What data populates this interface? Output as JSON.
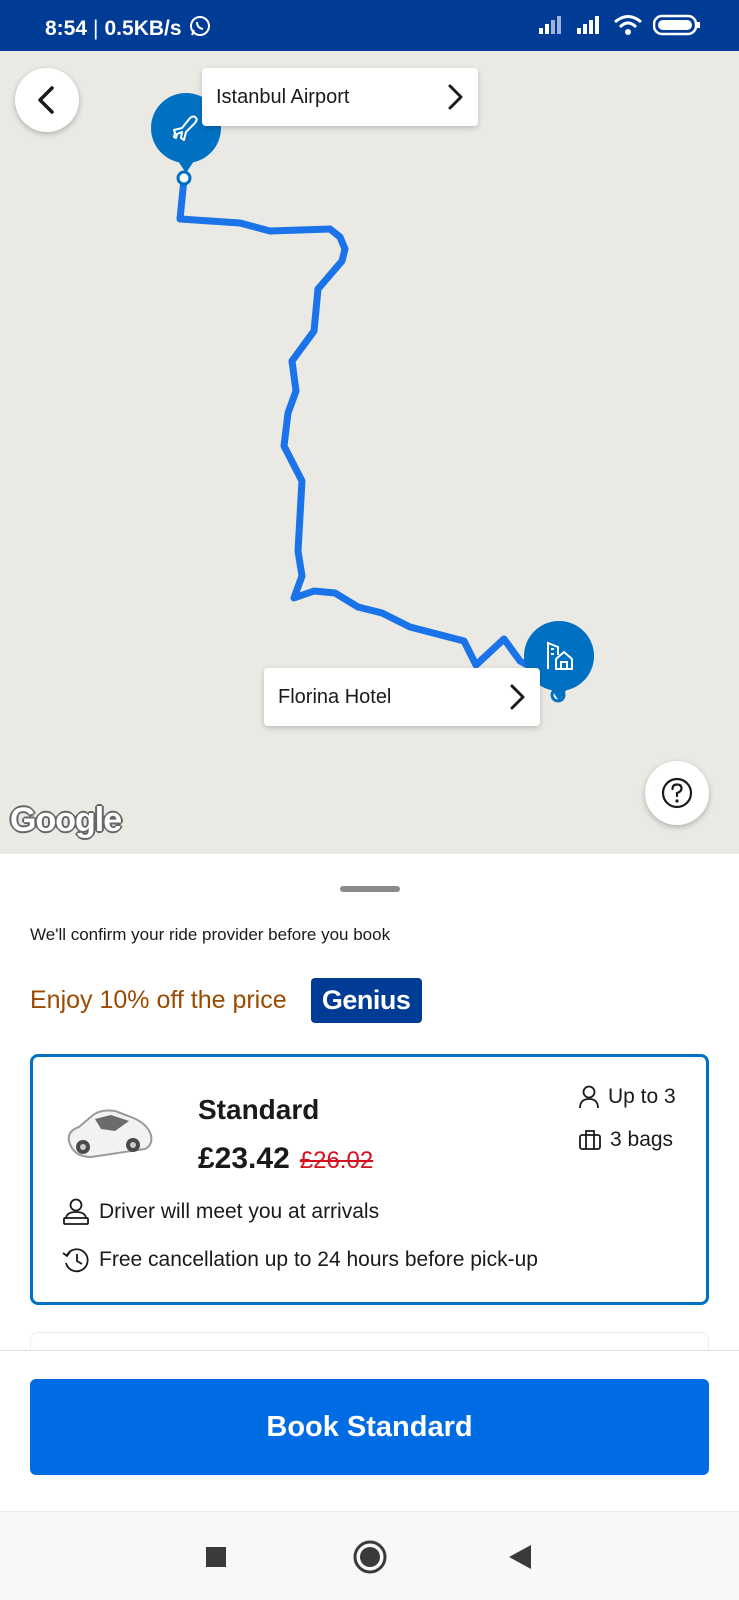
{
  "status": {
    "time": "8:54",
    "speed": "0.5KB/s"
  },
  "map": {
    "origin_label": "Istanbul Airport",
    "destination_label": "Florina Hotel",
    "attribution": "Google"
  },
  "sheet": {
    "confirm_text": "We'll confirm your ride provider before you book",
    "discount_text": "Enjoy 10% off the price",
    "genius_badge": "Genius"
  },
  "vehicle": {
    "name": "Standard",
    "price": "£23.42",
    "old_price": "£26.02",
    "passengers": "Up to 3",
    "bags": "3 bags",
    "feature_meet": "Driver will meet you at arrivals",
    "feature_cancel": "Free cancellation up to 24 hours before pick-up"
  },
  "book_button_label": "Book Standard",
  "colors": {
    "brand_dark": "#003b95",
    "primary": "#006ce4",
    "pin": "#0071c2",
    "discount": "#9c4a00",
    "strike": "#d4111e"
  }
}
